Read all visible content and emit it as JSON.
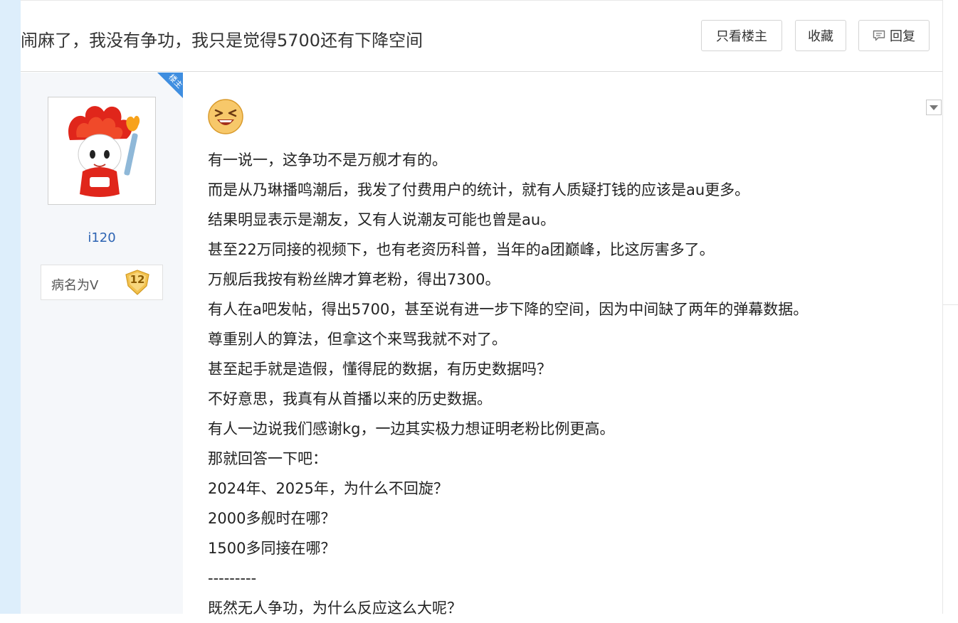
{
  "thread": {
    "title": "闹麻了，我没有争功，我只是觉得5700还有下降空间"
  },
  "toolbar": {
    "only_op_label": "只看楼主",
    "favorite_label": "收藏",
    "reply_label": "回复"
  },
  "author": {
    "op_tag": "楼主",
    "username": "i120",
    "badge_name": "病名为V",
    "badge_level": "12"
  },
  "colors": {
    "op_ribbon": "#3f8ee0",
    "username_link": "#2d64b3",
    "badge_gold": "#f2c14e",
    "left_strip": "#ddeefb"
  },
  "icons": {
    "reply": "speech-bubble-icon",
    "emoji": "laughing-face-icon",
    "menu": "triangle-down-icon"
  },
  "post": {
    "lines": [
      "有一说一，这争功不是万舰才有的。",
      "而是从乃琳播鸣潮后，我发了付费用户的统计，就有人质疑打钱的应该是au更多。",
      "结果明显表示是潮友，又有人说潮友可能也曾是au。",
      "甚至22万同接的视频下，也有老资历科普，当年的a团巅峰，比这厉害多了。",
      "万舰后我按有粉丝牌才算老粉，得出7300。",
      "有人在a吧发帖，得出5700，甚至说有进一步下降的空间，因为中间缺了两年的弹幕数据。",
      "尊重别人的算法，但拿这个来骂我就不对了。",
      "甚至起手就是造假，懂得屁的数据，有历史数据吗？",
      "不好意思，我真有从首播以来的历史数据。",
      "有人一边说我们感谢kg，一边其实极力想证明老粉比例更高。",
      "那就回答一下吧：",
      "2024年、2025年，为什么不回旋？",
      "2000多舰时在哪？",
      "1500多同接在哪？",
      "---------",
      "既然无人争功，为什么反应这么大呢？"
    ]
  }
}
